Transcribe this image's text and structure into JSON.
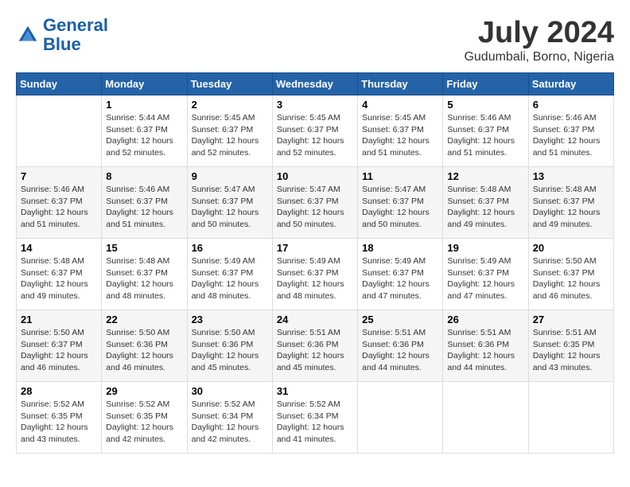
{
  "header": {
    "logo_line1": "General",
    "logo_line2": "Blue",
    "month": "July 2024",
    "location": "Gudumbali, Borno, Nigeria"
  },
  "days_of_week": [
    "Sunday",
    "Monday",
    "Tuesday",
    "Wednesday",
    "Thursday",
    "Friday",
    "Saturday"
  ],
  "weeks": [
    [
      {
        "day": "",
        "info": ""
      },
      {
        "day": "1",
        "info": "Sunrise: 5:44 AM\nSunset: 6:37 PM\nDaylight: 12 hours\nand 52 minutes."
      },
      {
        "day": "2",
        "info": "Sunrise: 5:45 AM\nSunset: 6:37 PM\nDaylight: 12 hours\nand 52 minutes."
      },
      {
        "day": "3",
        "info": "Sunrise: 5:45 AM\nSunset: 6:37 PM\nDaylight: 12 hours\nand 52 minutes."
      },
      {
        "day": "4",
        "info": "Sunrise: 5:45 AM\nSunset: 6:37 PM\nDaylight: 12 hours\nand 51 minutes."
      },
      {
        "day": "5",
        "info": "Sunrise: 5:46 AM\nSunset: 6:37 PM\nDaylight: 12 hours\nand 51 minutes."
      },
      {
        "day": "6",
        "info": "Sunrise: 5:46 AM\nSunset: 6:37 PM\nDaylight: 12 hours\nand 51 minutes."
      }
    ],
    [
      {
        "day": "7",
        "info": "Sunrise: 5:46 AM\nSunset: 6:37 PM\nDaylight: 12 hours\nand 51 minutes."
      },
      {
        "day": "8",
        "info": "Sunrise: 5:46 AM\nSunset: 6:37 PM\nDaylight: 12 hours\nand 51 minutes."
      },
      {
        "day": "9",
        "info": "Sunrise: 5:47 AM\nSunset: 6:37 PM\nDaylight: 12 hours\nand 50 minutes."
      },
      {
        "day": "10",
        "info": "Sunrise: 5:47 AM\nSunset: 6:37 PM\nDaylight: 12 hours\nand 50 minutes."
      },
      {
        "day": "11",
        "info": "Sunrise: 5:47 AM\nSunset: 6:37 PM\nDaylight: 12 hours\nand 50 minutes."
      },
      {
        "day": "12",
        "info": "Sunrise: 5:48 AM\nSunset: 6:37 PM\nDaylight: 12 hours\nand 49 minutes."
      },
      {
        "day": "13",
        "info": "Sunrise: 5:48 AM\nSunset: 6:37 PM\nDaylight: 12 hours\nand 49 minutes."
      }
    ],
    [
      {
        "day": "14",
        "info": "Sunrise: 5:48 AM\nSunset: 6:37 PM\nDaylight: 12 hours\nand 49 minutes."
      },
      {
        "day": "15",
        "info": "Sunrise: 5:48 AM\nSunset: 6:37 PM\nDaylight: 12 hours\nand 48 minutes."
      },
      {
        "day": "16",
        "info": "Sunrise: 5:49 AM\nSunset: 6:37 PM\nDaylight: 12 hours\nand 48 minutes."
      },
      {
        "day": "17",
        "info": "Sunrise: 5:49 AM\nSunset: 6:37 PM\nDaylight: 12 hours\nand 48 minutes."
      },
      {
        "day": "18",
        "info": "Sunrise: 5:49 AM\nSunset: 6:37 PM\nDaylight: 12 hours\nand 47 minutes."
      },
      {
        "day": "19",
        "info": "Sunrise: 5:49 AM\nSunset: 6:37 PM\nDaylight: 12 hours\nand 47 minutes."
      },
      {
        "day": "20",
        "info": "Sunrise: 5:50 AM\nSunset: 6:37 PM\nDaylight: 12 hours\nand 46 minutes."
      }
    ],
    [
      {
        "day": "21",
        "info": "Sunrise: 5:50 AM\nSunset: 6:37 PM\nDaylight: 12 hours\nand 46 minutes."
      },
      {
        "day": "22",
        "info": "Sunrise: 5:50 AM\nSunset: 6:36 PM\nDaylight: 12 hours\nand 46 minutes."
      },
      {
        "day": "23",
        "info": "Sunrise: 5:50 AM\nSunset: 6:36 PM\nDaylight: 12 hours\nand 45 minutes."
      },
      {
        "day": "24",
        "info": "Sunrise: 5:51 AM\nSunset: 6:36 PM\nDaylight: 12 hours\nand 45 minutes."
      },
      {
        "day": "25",
        "info": "Sunrise: 5:51 AM\nSunset: 6:36 PM\nDaylight: 12 hours\nand 44 minutes."
      },
      {
        "day": "26",
        "info": "Sunrise: 5:51 AM\nSunset: 6:36 PM\nDaylight: 12 hours\nand 44 minutes."
      },
      {
        "day": "27",
        "info": "Sunrise: 5:51 AM\nSunset: 6:35 PM\nDaylight: 12 hours\nand 43 minutes."
      }
    ],
    [
      {
        "day": "28",
        "info": "Sunrise: 5:52 AM\nSunset: 6:35 PM\nDaylight: 12 hours\nand 43 minutes."
      },
      {
        "day": "29",
        "info": "Sunrise: 5:52 AM\nSunset: 6:35 PM\nDaylight: 12 hours\nand 42 minutes."
      },
      {
        "day": "30",
        "info": "Sunrise: 5:52 AM\nSunset: 6:34 PM\nDaylight: 12 hours\nand 42 minutes."
      },
      {
        "day": "31",
        "info": "Sunrise: 5:52 AM\nSunset: 6:34 PM\nDaylight: 12 hours\nand 41 minutes."
      },
      {
        "day": "",
        "info": ""
      },
      {
        "day": "",
        "info": ""
      },
      {
        "day": "",
        "info": ""
      }
    ]
  ]
}
